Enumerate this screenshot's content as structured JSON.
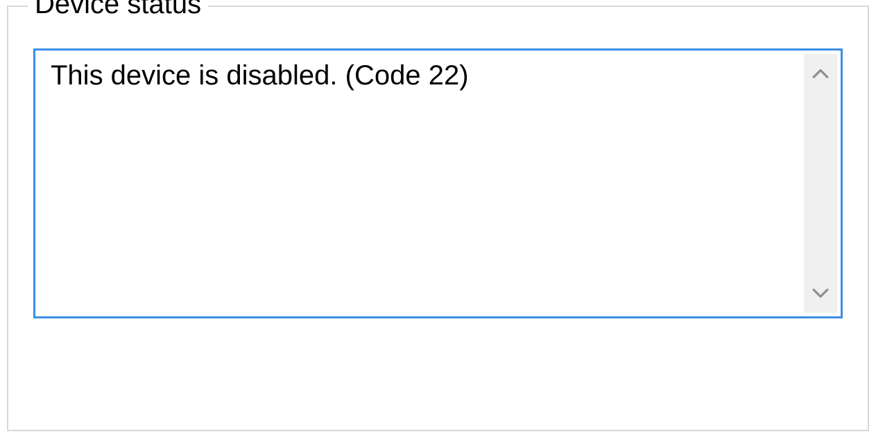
{
  "device_status": {
    "legend": "Device status",
    "message": "This device is disabled. (Code 22)"
  }
}
